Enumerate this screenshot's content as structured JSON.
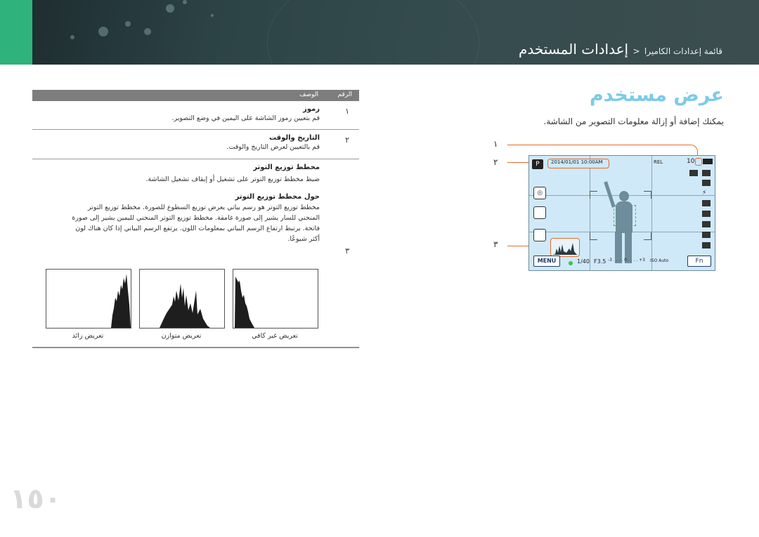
{
  "header": {
    "breadcrumb_small": "قائمة إعدادات الكاميرا",
    "breadcrumb_sep": "<",
    "breadcrumb_main": "إعدادات المستخدم"
  },
  "section": {
    "title": "عرض مستخدم",
    "intro": "يمكنك إضافة أو إزالة معلومات التصوير من الشاشة."
  },
  "callouts": [
    "١",
    "٢",
    "٣"
  ],
  "camera_screen": {
    "datetime": "2014/01/01 10:00AM",
    "rel": "REL",
    "shots": "10",
    "menu_label": "MENU",
    "shutter": "1/40",
    "aperture": "F3.5",
    "ev_scale": "-3 . . . . 0 . . . . +3",
    "iso": "ISO Auto",
    "fn_label": "Fn"
  },
  "table": {
    "col_number": "الرقم",
    "col_description": "الوصف",
    "rows": [
      {
        "number": "١",
        "title": "رموز",
        "text": "قم بتعيين رموز الشاشة على اليمين في وضع التصوير."
      },
      {
        "number": "٢",
        "title": "التاريخ والوقت",
        "text": "قم بالتعيين لعرض التاريخ والوقت."
      },
      {
        "number": "٣",
        "title": "مخطط توزيع التوتر",
        "text": "ضبط مخطط توزيع التوتر على تشغيل أو إيقاف تشغيل الشاشة.",
        "subtitle": "حول مخطط توزيع التوتر",
        "body": [
          "مخطط توزيع التوتر هو رسم بياني يعرض توزيع السطوع للصورة. مخطط توزيع التوتر",
          "المنحني للسار يشير إلى صورة غامقة. مخطط توزيع التوتر المنحني لليمين يشير إلى صورة",
          "فاتحة. يرتبط ارتفاع الرسم البياني بمعلومات اللون. يرتفع الرسم البياني إذا كان هناك لون",
          "أكثر شيوعًا."
        ]
      }
    ]
  },
  "histograms": [
    {
      "label": "تعريض غير كافي"
    },
    {
      "label": "تعريض متوازن"
    },
    {
      "label": "تعريض زائد"
    }
  ],
  "page_number": "١٥٠"
}
